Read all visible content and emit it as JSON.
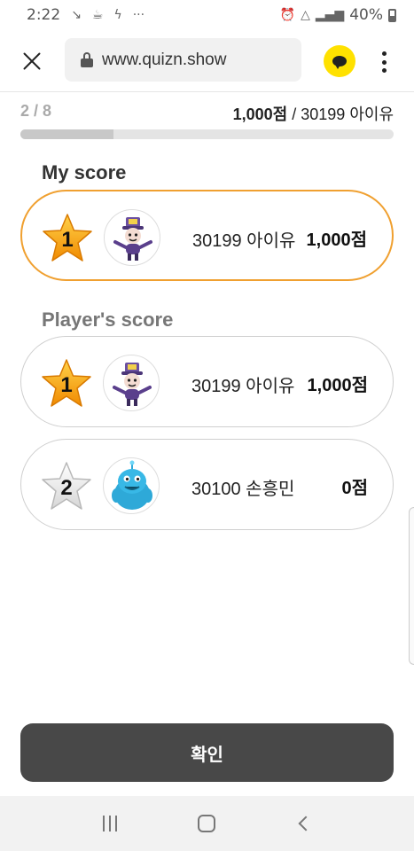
{
  "status_bar": {
    "time": "2:22",
    "dots": "···",
    "battery": "40%",
    "icons": [
      "missed-call-icon",
      "notification-icon",
      "cup-icon",
      "data-icon",
      "alarm-icon",
      "wifi-icon",
      "signal-icon",
      "battery-icon"
    ]
  },
  "browser": {
    "url": "www.quizn.show",
    "icons": [
      "close-icon",
      "lock-icon",
      "kakao-chat-icon",
      "more-vert-icon"
    ]
  },
  "progress": {
    "label": "2 / 8",
    "current": 2,
    "total": 8,
    "score_value": "1,000점",
    "score_separator": " / ",
    "score_player": "30199 아이유"
  },
  "my_score": {
    "title": "My score",
    "entry": {
      "rank": "1",
      "name": "30199 아이유",
      "points": "1,000점",
      "star": "gold",
      "avatar": "purple-hat-character"
    }
  },
  "players": {
    "title": "Player's score",
    "entries": [
      {
        "rank": "1",
        "name": "30199 아이유",
        "points": "1,000점",
        "star": "gold",
        "avatar": "purple-hat-character"
      },
      {
        "rank": "2",
        "name": "30100 손흥민",
        "points": "0점",
        "star": "silver",
        "avatar": "blue-monster-character"
      }
    ]
  },
  "confirm_button": {
    "label": "확인"
  },
  "colors": {
    "highlight_border": "#f0a030",
    "gold_star": "#f59a0e",
    "silver_star": "#e8e8e8",
    "button_bg": "#484848",
    "kakao_yellow": "#ffe100"
  }
}
